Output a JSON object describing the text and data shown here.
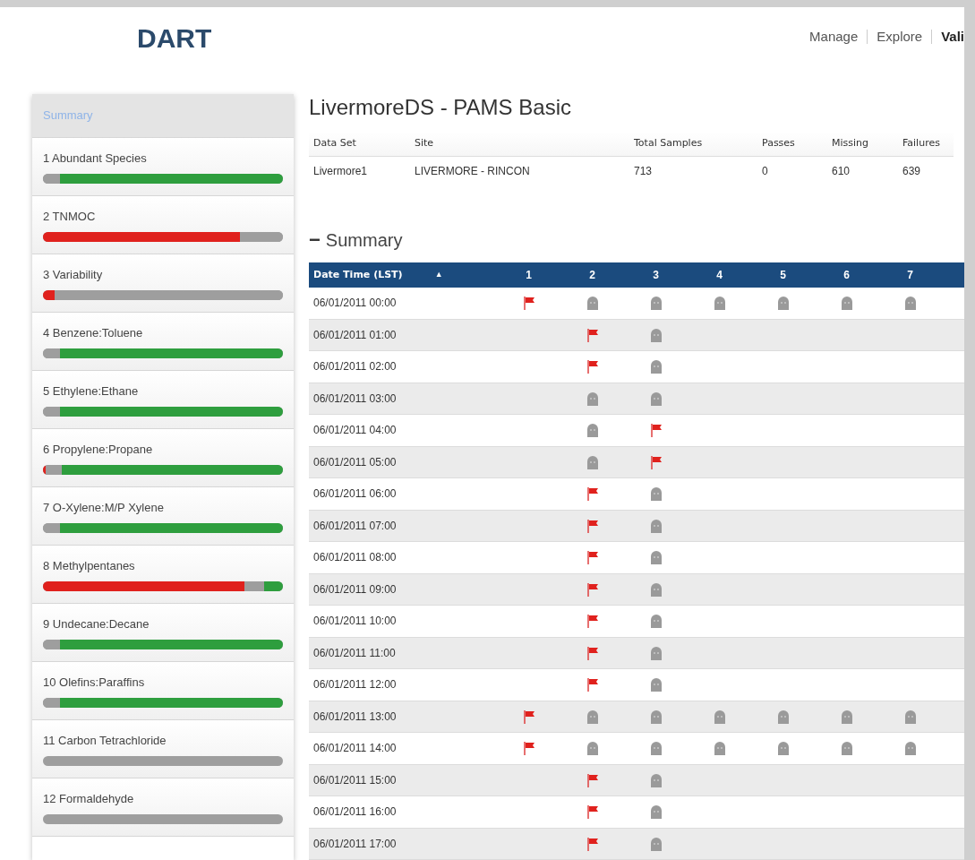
{
  "header": {
    "logo": "DART",
    "nav": [
      {
        "label": "Manage",
        "selected": false
      },
      {
        "label": "Explore",
        "selected": false
      },
      {
        "label": "Vali",
        "selected": true
      }
    ]
  },
  "sidebar": {
    "items": [
      {
        "label": "Summary",
        "selected": true
      },
      {
        "label": "1 Abundant Species",
        "selected": false,
        "segments": [
          {
            "color": "#9e9e9e",
            "level": 0.07
          },
          {
            "color": "#2e9e3e",
            "level": 0.93
          }
        ]
      },
      {
        "label": "2 TNMOC",
        "selected": false,
        "segments": [
          {
            "color": "#e0211d",
            "level": 0.82
          },
          {
            "color": "#9e9e9e",
            "level": 0.18
          }
        ]
      },
      {
        "label": "3 Variability",
        "selected": false,
        "segments": [
          {
            "color": "#e0211d",
            "level": 0.05
          },
          {
            "color": "#9e9e9e",
            "level": 0.95
          }
        ]
      },
      {
        "label": "4 Benzene:Toluene",
        "selected": false,
        "segments": [
          {
            "color": "#9e9e9e",
            "level": 0.07
          },
          {
            "color": "#2e9e3e",
            "level": 0.93
          }
        ]
      },
      {
        "label": "5 Ethylene:Ethane",
        "selected": false,
        "segments": [
          {
            "color": "#9e9e9e",
            "level": 0.07
          },
          {
            "color": "#2e9e3e",
            "level": 0.93
          }
        ]
      },
      {
        "label": "6 Propylene:Propane",
        "selected": false,
        "segments": [
          {
            "color": "#e0211d",
            "level": 0.01
          },
          {
            "color": "#9e9e9e"
          },
          {
            "color": "#2e9e3e",
            "level": 0.92
          }
        ]
      },
      {
        "label": "7 O-Xylene:M/P Xylene",
        "selected": false,
        "segments": [
          {
            "color": "#9e9e9e",
            "level": 0.07
          },
          {
            "color": "#2e9e3e",
            "level": 0.93
          }
        ]
      },
      {
        "label": "8 Methylpentanes",
        "selected": false,
        "segments": [
          {
            "color": "#e0211d",
            "level": 0.84
          },
          {
            "color": "#9e9e9e"
          },
          {
            "color": "#2e9e3e",
            "level": 0.08
          }
        ]
      },
      {
        "label": "9 Undecane:Decane",
        "selected": false,
        "segments": [
          {
            "color": "#9e9e9e",
            "level": 0.07
          },
          {
            "color": "#2e9e3e",
            "level": 0.93
          }
        ]
      },
      {
        "label": "10 Olefins:Paraffins",
        "selected": false,
        "segments": [
          {
            "color": "#9e9e9e",
            "level": 0.07
          },
          {
            "color": "#2e9e3e",
            "level": 0.93
          }
        ]
      },
      {
        "label": "11 Carbon Tetrachloride",
        "selected": false,
        "segments": [
          {
            "color": "#9e9e9e",
            "level": 1
          }
        ]
      },
      {
        "label": "12 Formaldehyde",
        "selected": false,
        "segments": [
          {
            "color": "#9e9e9e",
            "level": 1
          }
        ]
      }
    ]
  },
  "title": "LivermoreDS - PAMS Basic",
  "info_table": {
    "columns": [
      "Data Set",
      "Site",
      "Total Samples",
      "Passes",
      "Missing",
      "Failures"
    ],
    "row": [
      "Livermore1",
      "LIVERMORE - RINCON",
      "713",
      "0",
      "610",
      "639"
    ]
  },
  "section": {
    "toggle": "−",
    "title": "Summary",
    "expanded": true
  },
  "grid": {
    "columns": [
      "Date Time (LST)",
      "1",
      "2",
      "3",
      "4",
      "5",
      "6",
      "7"
    ],
    "sort_indicator": "▲",
    "rows": [
      {
        "time": "06/01/2011 00:00",
        "cells": [
          {
            "kind": "flag"
          },
          {
            "kind": "missing"
          },
          {
            "kind": "missing"
          },
          {
            "kind": "missing"
          },
          {
            "kind": "missing"
          },
          {
            "kind": "missing"
          },
          {
            "kind": "missing"
          }
        ]
      },
      {
        "time": "06/01/2011 01:00",
        "cells": [
          {
            "kind": "empty"
          },
          {
            "kind": "flag"
          },
          {
            "kind": "missing"
          },
          {
            "kind": "empty"
          },
          {
            "kind": "empty"
          },
          {
            "kind": "empty"
          },
          {
            "kind": "empty"
          }
        ]
      },
      {
        "time": "06/01/2011 02:00",
        "cells": [
          {
            "kind": "empty"
          },
          {
            "kind": "flag"
          },
          {
            "kind": "missing"
          },
          {
            "kind": "empty"
          },
          {
            "kind": "empty"
          },
          {
            "kind": "empty"
          },
          {
            "kind": "empty"
          }
        ]
      },
      {
        "time": "06/01/2011 03:00",
        "cells": [
          {
            "kind": "empty"
          },
          {
            "kind": "missing"
          },
          {
            "kind": "missing"
          },
          {
            "kind": "empty"
          },
          {
            "kind": "empty"
          },
          {
            "kind": "empty"
          },
          {
            "kind": "empty"
          }
        ]
      },
      {
        "time": "06/01/2011 04:00",
        "cells": [
          {
            "kind": "empty"
          },
          {
            "kind": "missing"
          },
          {
            "kind": "flag"
          },
          {
            "kind": "empty"
          },
          {
            "kind": "empty"
          },
          {
            "kind": "empty"
          },
          {
            "kind": "empty"
          }
        ]
      },
      {
        "time": "06/01/2011 05:00",
        "cells": [
          {
            "kind": "empty"
          },
          {
            "kind": "missing"
          },
          {
            "kind": "flag"
          },
          {
            "kind": "empty"
          },
          {
            "kind": "empty"
          },
          {
            "kind": "empty"
          },
          {
            "kind": "empty"
          }
        ]
      },
      {
        "time": "06/01/2011 06:00",
        "cells": [
          {
            "kind": "empty"
          },
          {
            "kind": "flag"
          },
          {
            "kind": "missing"
          },
          {
            "kind": "empty"
          },
          {
            "kind": "empty"
          },
          {
            "kind": "empty"
          },
          {
            "kind": "empty"
          }
        ]
      },
      {
        "time": "06/01/2011 07:00",
        "cells": [
          {
            "kind": "empty"
          },
          {
            "kind": "flag"
          },
          {
            "kind": "missing"
          },
          {
            "kind": "empty"
          },
          {
            "kind": "empty"
          },
          {
            "kind": "empty"
          },
          {
            "kind": "empty"
          }
        ]
      },
      {
        "time": "06/01/2011 08:00",
        "cells": [
          {
            "kind": "empty"
          },
          {
            "kind": "flag"
          },
          {
            "kind": "missing"
          },
          {
            "kind": "empty"
          },
          {
            "kind": "empty"
          },
          {
            "kind": "empty"
          },
          {
            "kind": "empty"
          }
        ]
      },
      {
        "time": "06/01/2011 09:00",
        "cells": [
          {
            "kind": "empty"
          },
          {
            "kind": "flag"
          },
          {
            "kind": "missing"
          },
          {
            "kind": "empty"
          },
          {
            "kind": "empty"
          },
          {
            "kind": "empty"
          },
          {
            "kind": "empty"
          }
        ]
      },
      {
        "time": "06/01/2011 10:00",
        "cells": [
          {
            "kind": "empty"
          },
          {
            "kind": "flag"
          },
          {
            "kind": "missing"
          },
          {
            "kind": "empty"
          },
          {
            "kind": "empty"
          },
          {
            "kind": "empty"
          },
          {
            "kind": "empty"
          }
        ]
      },
      {
        "time": "06/01/2011 11:00",
        "cells": [
          {
            "kind": "empty"
          },
          {
            "kind": "flag"
          },
          {
            "kind": "missing"
          },
          {
            "kind": "empty"
          },
          {
            "kind": "empty"
          },
          {
            "kind": "empty"
          },
          {
            "kind": "empty"
          }
        ]
      },
      {
        "time": "06/01/2011 12:00",
        "cells": [
          {
            "kind": "empty"
          },
          {
            "kind": "flag"
          },
          {
            "kind": "missing"
          },
          {
            "kind": "empty"
          },
          {
            "kind": "empty"
          },
          {
            "kind": "empty"
          },
          {
            "kind": "empty"
          }
        ]
      },
      {
        "time": "06/01/2011 13:00",
        "cells": [
          {
            "kind": "flag"
          },
          {
            "kind": "missing"
          },
          {
            "kind": "missing"
          },
          {
            "kind": "missing"
          },
          {
            "kind": "missing"
          },
          {
            "kind": "missing"
          },
          {
            "kind": "missing"
          }
        ]
      },
      {
        "time": "06/01/2011 14:00",
        "cells": [
          {
            "kind": "flag"
          },
          {
            "kind": "missing"
          },
          {
            "kind": "missing"
          },
          {
            "kind": "missing"
          },
          {
            "kind": "missing"
          },
          {
            "kind": "missing"
          },
          {
            "kind": "missing"
          }
        ]
      },
      {
        "time": "06/01/2011 15:00",
        "cells": [
          {
            "kind": "empty"
          },
          {
            "kind": "flag"
          },
          {
            "kind": "missing"
          },
          {
            "kind": "empty"
          },
          {
            "kind": "empty"
          },
          {
            "kind": "empty"
          },
          {
            "kind": "empty"
          }
        ]
      },
      {
        "time": "06/01/2011 16:00",
        "cells": [
          {
            "kind": "empty"
          },
          {
            "kind": "flag"
          },
          {
            "kind": "missing"
          },
          {
            "kind": "empty"
          },
          {
            "kind": "empty"
          },
          {
            "kind": "empty"
          },
          {
            "kind": "empty"
          }
        ]
      },
      {
        "time": "06/01/2011 17:00",
        "cells": [
          {
            "kind": "empty"
          },
          {
            "kind": "flag"
          },
          {
            "kind": "missing"
          },
          {
            "kind": "empty"
          },
          {
            "kind": "empty"
          },
          {
            "kind": "empty"
          },
          {
            "kind": "empty"
          }
        ]
      }
    ]
  }
}
